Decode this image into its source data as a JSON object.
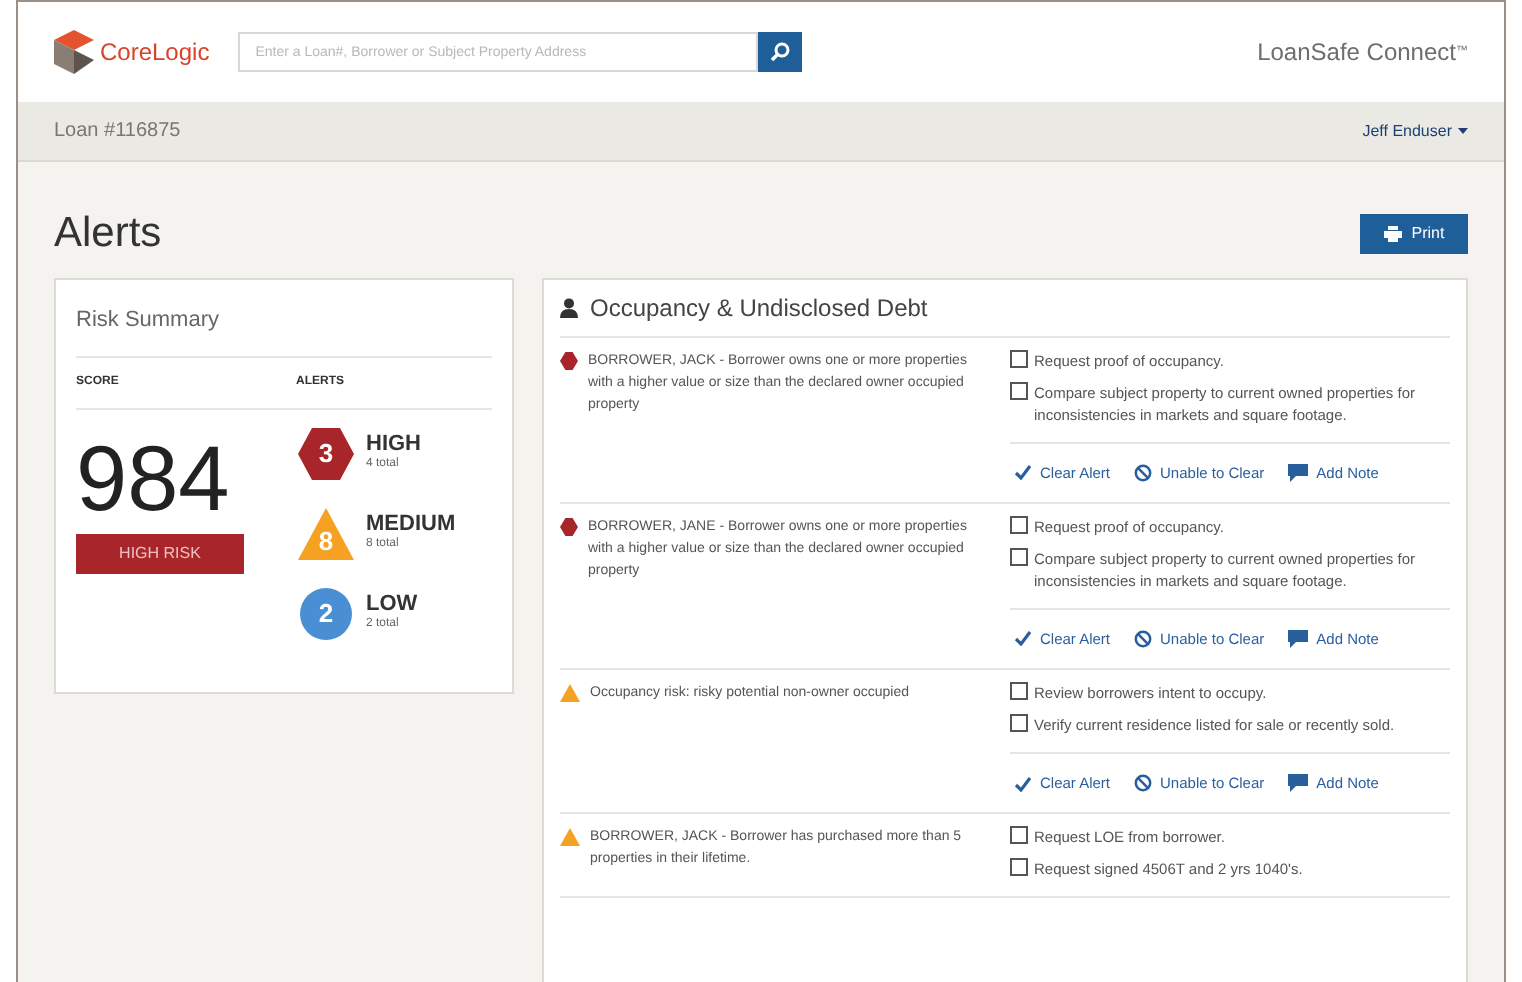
{
  "header": {
    "logo_text": "CoreLogic",
    "search": {
      "placeholder": "Enter a Loan#, Borrower or Subject Property Address"
    },
    "product": "LoanSafe Connect",
    "product_mark": "™"
  },
  "loan_bar": {
    "loan": "Loan #116875",
    "user": "Jeff Enduser"
  },
  "page": {
    "title": "Alerts",
    "print_button": "Print"
  },
  "risk_summary": {
    "title": "Risk Summary",
    "score_heading": "SCORE",
    "alerts_heading": "ALERTS",
    "score": "984",
    "risk_label": "HIGH RISK",
    "levels": [
      {
        "kind": "high",
        "count": "3",
        "label": "HIGH",
        "total": "4 total"
      },
      {
        "kind": "medium",
        "count": "8",
        "label": "MEDIUM",
        "total": "8 total"
      },
      {
        "kind": "low",
        "count": "2",
        "label": "LOW",
        "total": "2 total"
      }
    ]
  },
  "alert_panel": {
    "title": "Occupancy & Undisclosed Debt",
    "alerts": [
      {
        "kind": "high",
        "text": "BORROWER, JACK - Borrower owns one or more properties with a higher value or size than the declared owner occupied property",
        "tasks": [
          {
            "label": "Request proof of occupancy.",
            "checked": false
          },
          {
            "label": "Compare subject property to current owned properties for inconsistencies in markets and square footage.",
            "checked": false
          }
        ],
        "actions": [
          {
            "kind": "clear",
            "label": "Clear Alert"
          },
          {
            "kind": "unable",
            "label": "Unable to Clear"
          },
          {
            "kind": "note",
            "label": "Add Note"
          }
        ]
      },
      {
        "kind": "high",
        "text": "BORROWER, JANE - Borrower owns one or more properties with a higher value or size than the declared owner occupied property",
        "tasks": [
          {
            "label": "Request proof of occupancy.",
            "checked": false
          },
          {
            "label": "Compare subject property to current owned properties for inconsistencies in markets and square footage.",
            "checked": false
          }
        ],
        "actions": [
          {
            "kind": "clear",
            "label": "Clear Alert"
          },
          {
            "kind": "unable",
            "label": "Unable to Clear"
          },
          {
            "kind": "note",
            "label": "Add Note"
          }
        ]
      },
      {
        "kind": "medium",
        "text": "Occupancy risk: risky potential non-owner occupied",
        "tasks": [
          {
            "label": "Review borrowers intent to occupy.",
            "checked": false
          },
          {
            "label": "Verify current residence listed for sale or recently sold.",
            "checked": false
          }
        ],
        "actions": [
          {
            "kind": "clear",
            "label": "Clear Alert"
          },
          {
            "kind": "unable",
            "label": "Unable to Clear"
          },
          {
            "kind": "note",
            "label": "Add Note"
          }
        ]
      },
      {
        "kind": "medium",
        "text": "BORROWER, JACK - Borrower has purchased more than 5 properties in their lifetime.",
        "tasks": [
          {
            "label": "Request LOE from borrower.",
            "checked": false
          },
          {
            "label": "Request signed 4506T and 2 yrs 1040's.",
            "checked": false
          }
        ]
      }
    ]
  }
}
